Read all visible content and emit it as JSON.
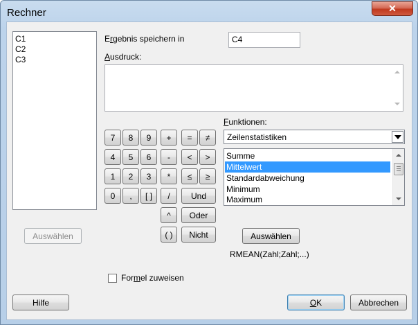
{
  "window": {
    "title": "Rechner",
    "close_glyph": "✕"
  },
  "columns": [
    "C1",
    "C2",
    "C3"
  ],
  "left_select_button": "Auswählen",
  "store_result": {
    "label_prefix": "E",
    "label_accel": "r",
    "label_rest": "gebnis speichern in",
    "value": "C4"
  },
  "expression": {
    "label_accel": "A",
    "label_rest": "usdruck:",
    "value": ""
  },
  "keypad": {
    "rows": [
      [
        "7",
        "8",
        "9",
        "+",
        "=",
        "≠"
      ],
      [
        "4",
        "5",
        "6",
        "-",
        "<",
        ">"
      ],
      [
        "1",
        "2",
        "3",
        "*",
        "≤",
        "≥"
      ],
      [
        "0",
        ",",
        "[ ]",
        "/"
      ]
    ],
    "und": "Und",
    "caret": "^",
    "oder": "Oder",
    "parens": "( )",
    "nicht": "Nicht"
  },
  "functions": {
    "label_accel": "F",
    "label_rest": "unktionen:",
    "category": "Zeilenstatistiken",
    "items": [
      "Summe",
      "Mittelwert",
      "Standardabweichung",
      "Minimum",
      "Maximum"
    ],
    "selected_index": 1,
    "select_button": "Auswählen",
    "syntax": "RMEAN(Zahl;Zahl;...)"
  },
  "assign_formula": {
    "label_pre": "For",
    "label_accel": "m",
    "label_post": "el zuweisen",
    "checked": false
  },
  "buttons": {
    "help": "Hilfe",
    "ok_accel": "O",
    "ok_rest": "K",
    "cancel": "Abbrechen"
  }
}
